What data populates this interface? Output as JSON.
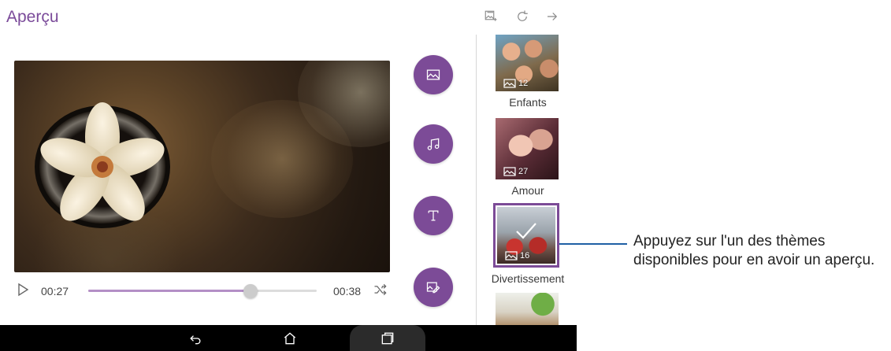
{
  "app": {
    "title": "Aperçu"
  },
  "top_actions": [
    {
      "icon": "add-photo-icon"
    },
    {
      "icon": "refresh-icon"
    },
    {
      "icon": "arrow-right-icon"
    }
  ],
  "player": {
    "current_time": "00:27",
    "total_time": "00:38",
    "progress": 0.71
  },
  "side_buttons": [
    {
      "icon": "image-icon"
    },
    {
      "icon": "music-icon"
    },
    {
      "icon": "text-icon"
    },
    {
      "icon": "edit-image-icon"
    }
  ],
  "themes": [
    {
      "label": "Enfants",
      "count": "12",
      "selected": false
    },
    {
      "label": "Amour",
      "count": "27",
      "selected": false
    },
    {
      "label": "Divertissement",
      "count": "16",
      "selected": true
    },
    {
      "label": "",
      "count": "",
      "selected": false
    }
  ],
  "navbar": [
    {
      "icon": "back-icon"
    },
    {
      "icon": "home-icon"
    },
    {
      "icon": "recent-apps-icon"
    }
  ],
  "callout": {
    "text": "Appuyez sur l'un des thèmes disponibles pour en avoir un aperçu."
  },
  "colors": {
    "accent": "#7c4b97",
    "title": "#7b4b9a",
    "callout_line": "#1f5fa5",
    "progress_fill": "#b48fc6"
  }
}
